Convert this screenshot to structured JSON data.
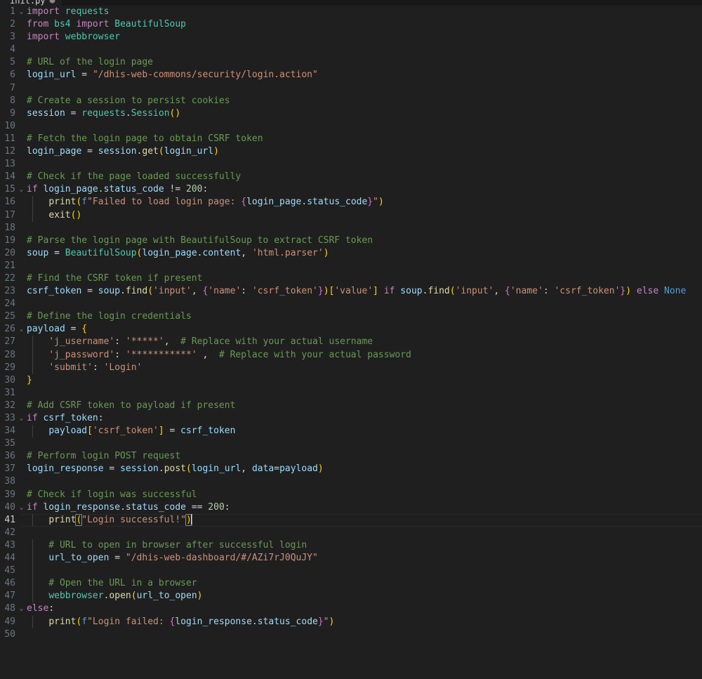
{
  "window": {
    "background_color": "#1f1f1f",
    "foreground_color": "#d4d4d4"
  },
  "tab": {
    "filename": "init.py",
    "modified_indicator": "●"
  },
  "editor": {
    "language": "Python",
    "active_line": 41,
    "cursor_column": 30,
    "total_lines": 50,
    "line_number_color": "#6e7681",
    "active_line_number_color": "#cccccc",
    "indent_guide_color": "#404040",
    "fold_chevron": "⌄",
    "fold_lines": [
      1,
      15,
      26,
      33,
      40,
      48
    ]
  },
  "colors": {
    "comment": "#6a9955",
    "string": "#ce9178",
    "keyword": "#c586c0",
    "keyword_blue": "#569cd6",
    "function": "#dcdcaa",
    "class": "#4ec9b0",
    "variable": "#9cdcfe",
    "number": "#b5cea8",
    "bracket1": "#ffd700",
    "bracket2": "#da70d6",
    "bracket3": "#179fff"
  },
  "lines": [
    {
      "n": 1,
      "text": "import requests"
    },
    {
      "n": 2,
      "text": "from bs4 import BeautifulSoup"
    },
    {
      "n": 3,
      "text": "import webbrowser"
    },
    {
      "n": 4,
      "text": ""
    },
    {
      "n": 5,
      "text": "# URL of the login page"
    },
    {
      "n": 6,
      "text": "login_url = \"/dhis-web-commons/security/login.action\""
    },
    {
      "n": 7,
      "text": ""
    },
    {
      "n": 8,
      "text": "# Create a session to persist cookies"
    },
    {
      "n": 9,
      "text": "session = requests.Session()"
    },
    {
      "n": 10,
      "text": ""
    },
    {
      "n": 11,
      "text": "# Fetch the login page to obtain CSRF token"
    },
    {
      "n": 12,
      "text": "login_page = session.get(login_url)"
    },
    {
      "n": 13,
      "text": ""
    },
    {
      "n": 14,
      "text": "# Check if the page loaded successfully"
    },
    {
      "n": 15,
      "text": "if login_page.status_code != 200:"
    },
    {
      "n": 16,
      "text": "    print(f\"Failed to load login page: {login_page.status_code}\")"
    },
    {
      "n": 17,
      "text": "    exit()"
    },
    {
      "n": 18,
      "text": ""
    },
    {
      "n": 19,
      "text": "# Parse the login page with BeautifulSoup to extract CSRF token"
    },
    {
      "n": 20,
      "text": "soup = BeautifulSoup(login_page.content, 'html.parser')"
    },
    {
      "n": 21,
      "text": ""
    },
    {
      "n": 22,
      "text": "# Find the CSRF token if present"
    },
    {
      "n": 23,
      "text": "csrf_token = soup.find('input', {'name': 'csrf_token'})['value'] if soup.find('input', {'name': 'csrf_token'}) else None"
    },
    {
      "n": 24,
      "text": ""
    },
    {
      "n": 25,
      "text": "# Define the login credentials"
    },
    {
      "n": 26,
      "text": "payload = {"
    },
    {
      "n": 27,
      "text": "    'j_username': '*****',  # Replace with your actual username"
    },
    {
      "n": 28,
      "text": "    'j_password': '***********' ,  # Replace with your actual password"
    },
    {
      "n": 29,
      "text": "    'submit': 'Login'"
    },
    {
      "n": 30,
      "text": "}"
    },
    {
      "n": 31,
      "text": ""
    },
    {
      "n": 32,
      "text": "# Add CSRF token to payload if present"
    },
    {
      "n": 33,
      "text": "if csrf_token:"
    },
    {
      "n": 34,
      "text": "    payload['csrf_token'] = csrf_token"
    },
    {
      "n": 35,
      "text": ""
    },
    {
      "n": 36,
      "text": "# Perform login POST request"
    },
    {
      "n": 37,
      "text": "login_response = session.post(login_url, data=payload)"
    },
    {
      "n": 38,
      "text": ""
    },
    {
      "n": 39,
      "text": "# Check if login was successful"
    },
    {
      "n": 40,
      "text": "if login_response.status_code == 200:"
    },
    {
      "n": 41,
      "text": "    print(\"Login successful!\")"
    },
    {
      "n": 42,
      "text": ""
    },
    {
      "n": 43,
      "text": "    # URL to open in browser after successful login"
    },
    {
      "n": 44,
      "text": "    url_to_open = \"/dhis-web-dashboard/#/AZi7rJ0QuJY\""
    },
    {
      "n": 45,
      "text": ""
    },
    {
      "n": 46,
      "text": "    # Open the URL in a browser"
    },
    {
      "n": 47,
      "text": "    webbrowser.open(url_to_open)"
    },
    {
      "n": 48,
      "text": "else:"
    },
    {
      "n": 49,
      "text": "    print(f\"Login failed: {login_response.status_code}\")"
    },
    {
      "n": 50,
      "text": ""
    }
  ]
}
